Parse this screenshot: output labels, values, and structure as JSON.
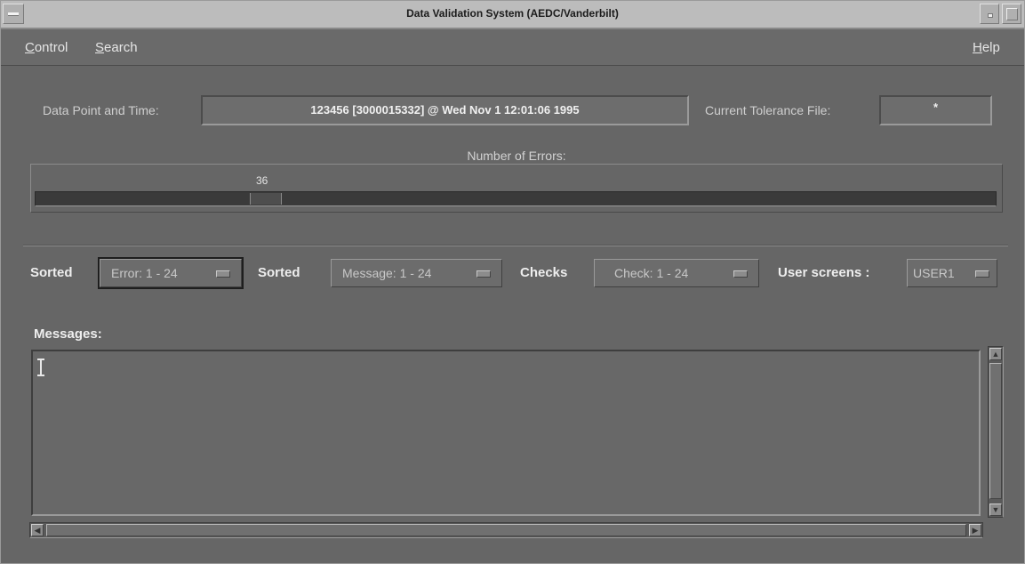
{
  "window": {
    "title": "Data Validation System (AEDC/Vanderbilt)"
  },
  "menubar": {
    "control_accel": "C",
    "control_rest": "ontrol",
    "search_accel": "S",
    "search_rest": "earch",
    "help_accel": "H",
    "help_rest": "elp"
  },
  "datapoint": {
    "label": "Data Point and Time:",
    "value": "123456 [3000015332] @ Wed Nov  1 12:01:06 1995"
  },
  "tolerance": {
    "label": "Current Tolerance File:",
    "value": "*"
  },
  "errors_gauge": {
    "label": "Number of Errors:",
    "value": "36",
    "fraction": 0.23
  },
  "options": {
    "sorted_errors_label": "Sorted",
    "sorted_errors_value": "Error: 1 - 24",
    "sorted_messages_label": "Sorted",
    "sorted_messages_value": "Message: 1 - 24",
    "checks_label": "Checks",
    "checks_value": "Check: 1 - 24",
    "user_screens_label": "User screens :",
    "user_screens_value": "USER1"
  },
  "messages": {
    "label": "Messages:",
    "text": ""
  },
  "colors": {
    "window_bg": "#666666",
    "titlebar_bg": "#bcbcbc",
    "gauge_track": "#3a3a3a"
  }
}
